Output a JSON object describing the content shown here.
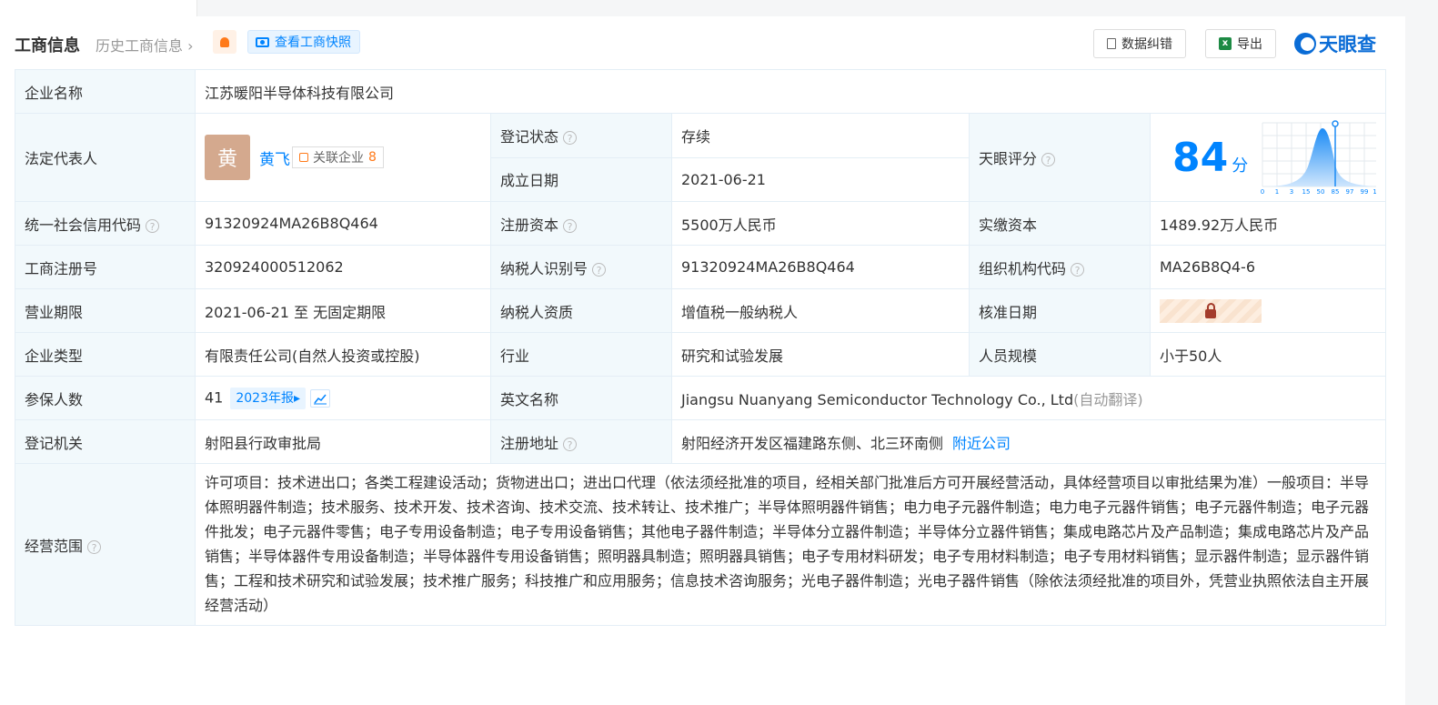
{
  "header": {
    "title": "工商信息",
    "history_link": "历史工商信息",
    "snapshot_button": "查看工商快照",
    "correction_button": "数据纠错",
    "export_button": "导出",
    "logo_text": "天眼查"
  },
  "colors": {
    "accent": "#0084ff",
    "status_green": "#0aa04a",
    "label_bg": "#f2f9fc",
    "bell": "#ff7a1a"
  },
  "icons": [
    "bell-icon",
    "camera-icon",
    "document-icon",
    "excel-icon",
    "help-icon",
    "lock-icon",
    "trend-chart-icon",
    "related-company-icon"
  ],
  "company": {
    "name_label": "企业名称",
    "name": "江苏暖阳半导体科技有限公司",
    "rep_label": "法定代表人",
    "rep_avatar": "黄",
    "rep_name": "黄飞",
    "related_label": "关联企业",
    "related_count": "8",
    "status_label": "登记状态",
    "status": "存续",
    "founded_label": "成立日期",
    "founded": "2021-06-21",
    "score_label": "天眼评分",
    "score": "84",
    "score_unit": "分",
    "score_axis": [
      "0",
      "1",
      "3",
      "15",
      "50",
      "85",
      "97",
      "99",
      "100"
    ],
    "credit_code_label": "统一社会信用代码",
    "credit_code": "91320924MA26B8Q464",
    "reg_capital_label": "注册资本",
    "reg_capital": "5500万人民币",
    "paid_capital_label": "实缴资本",
    "paid_capital": "1489.92万人民币",
    "reg_no_label": "工商注册号",
    "reg_no": "320924000512062",
    "taxpayer_id_label": "纳税人识别号",
    "taxpayer_id": "91320924MA26B8Q464",
    "org_code_label": "组织机构代码",
    "org_code": "MA26B8Q4-6",
    "term_label": "营业期限",
    "term": "2021-06-21 至 无固定期限",
    "taxpayer_qual_label": "纳税人资质",
    "taxpayer_qual": "增值税一般纳税人",
    "approval_date_label": "核准日期",
    "type_label": "企业类型",
    "type": "有限责任公司(自然人投资或控股)",
    "industry_label": "行业",
    "industry": "研究和试验发展",
    "staff_label": "人员规模",
    "staff": "小于50人",
    "insured_label": "参保人数",
    "insured": "41",
    "insured_year": "2023年报",
    "english_name_label": "英文名称",
    "english_name": "Jiangsu Nuanyang Semiconductor Technology Co., Ltd",
    "auto_translate": "(自动翻译)",
    "authority_label": "登记机关",
    "authority": "射阳县行政审批局",
    "address_label": "注册地址",
    "address": "射阳经济开发区福建路东侧、北三环南侧",
    "nearby_link": "附近公司",
    "scope_label": "经营范围",
    "scope": "许可项目：技术进出口；各类工程建设活动；货物进出口；进出口代理（依法须经批准的项目，经相关部门批准后方可开展经营活动，具体经营项目以审批结果为准）一般项目：半导体照明器件制造；技术服务、技术开发、技术咨询、技术交流、技术转让、技术推广；半导体照明器件销售；电力电子元器件制造；电力电子元器件销售；电子元器件制造；电子元器件批发；电子元器件零售；电子专用设备制造；电子专用设备销售；其他电子器件制造；半导体分立器件制造；半导体分立器件销售；集成电路芯片及产品制造；集成电路芯片及产品销售；半导体器件专用设备制造；半导体器件专用设备销售；照明器具制造；照明器具销售；电子专用材料研发；电子专用材料制造；电子专用材料销售；显示器件制造；显示器件销售；工程和技术研究和试验发展；技术推广服务；科技推广和应用服务；信息技术咨询服务；光电子器件制造；光电子器件销售（除依法须经批准的项目外，凭营业执照依法自主开展经营活动）"
  }
}
